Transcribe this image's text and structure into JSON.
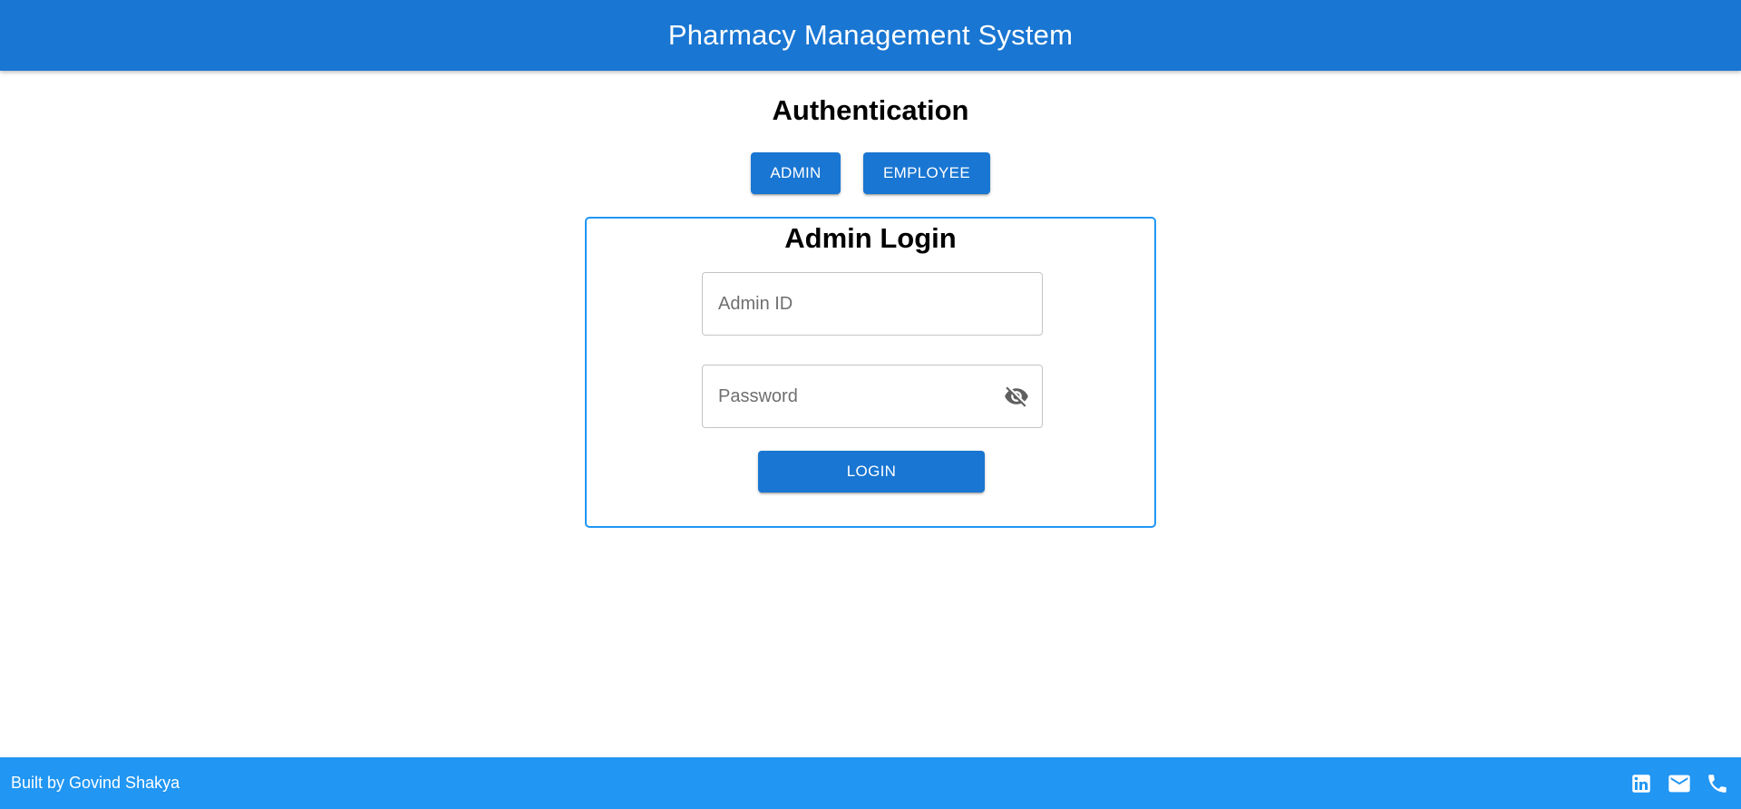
{
  "header": {
    "title": "Pharmacy Management System"
  },
  "auth": {
    "heading": "Authentication",
    "admin_button": "ADMIN",
    "employee_button": "EMPLOYEE"
  },
  "login_card": {
    "title": "Admin Login",
    "admin_id_placeholder": "Admin ID",
    "password_placeholder": "Password",
    "password_toggle_icon": "visibility-off-icon",
    "login_button": "LOGIN"
  },
  "footer": {
    "credit": "Built by Govind Shakya",
    "icons": [
      "linkedin-icon",
      "email-icon",
      "phone-icon"
    ]
  },
  "colors": {
    "app_bar": "#1976d2",
    "primary_button": "#1976d2",
    "footer": "#2196f3",
    "card_border": "#2196f3"
  }
}
